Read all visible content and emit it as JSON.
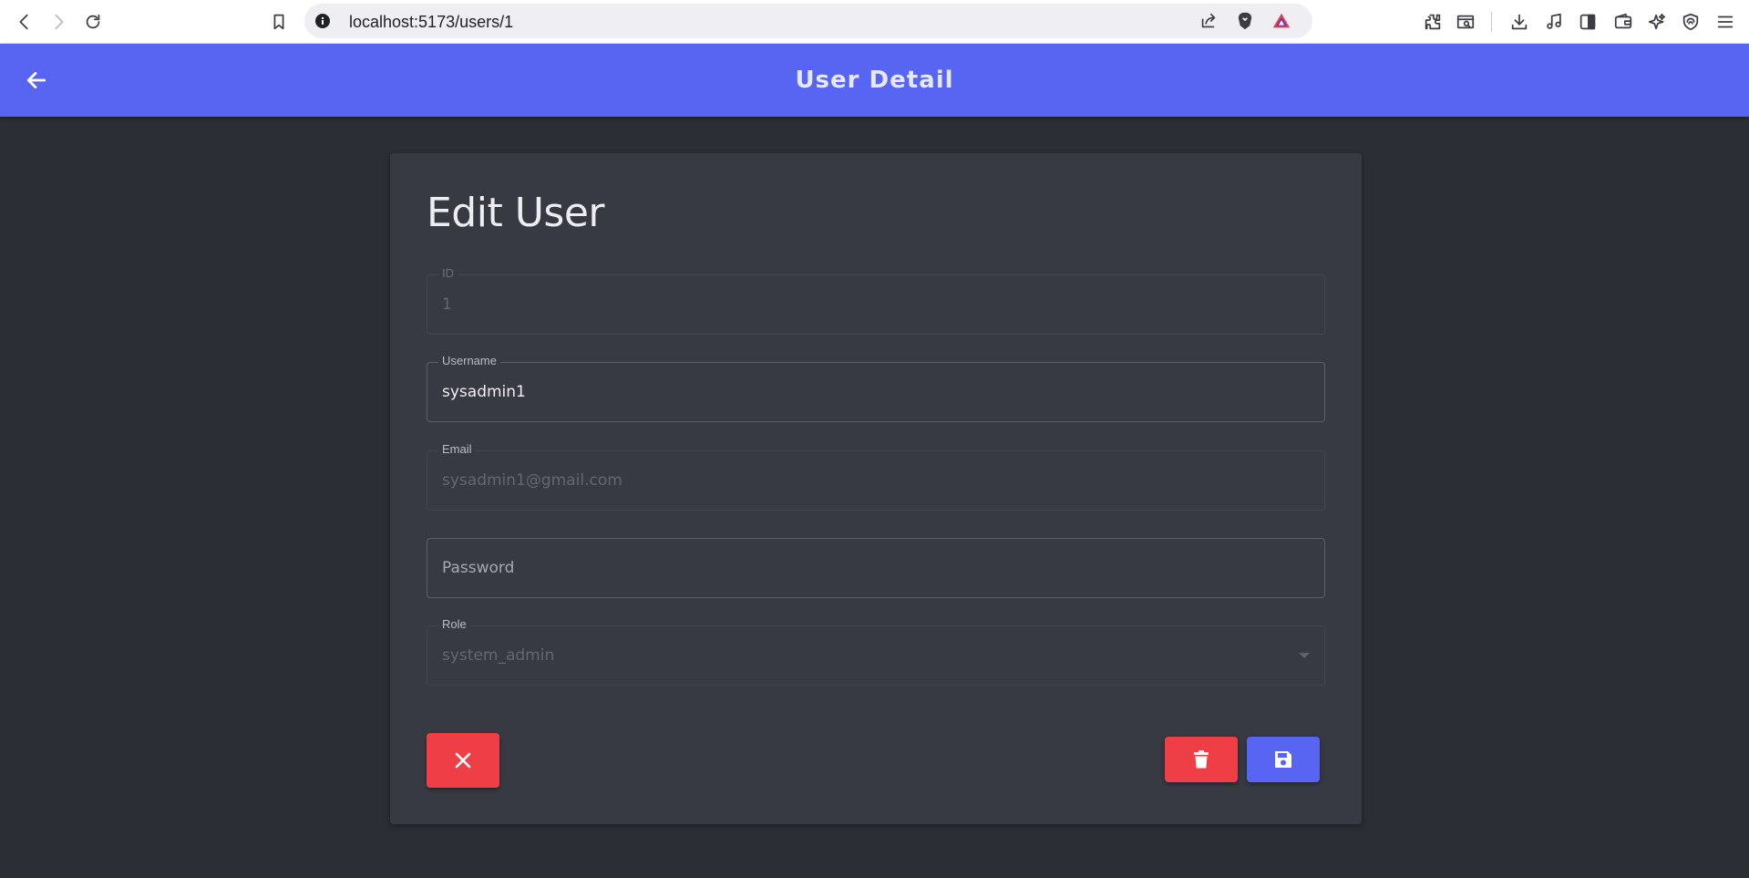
{
  "browser": {
    "url": "localhost:5173/users/1",
    "nav_icons": [
      "back-icon",
      "forward-icon",
      "reload-icon",
      "bookmark-icon"
    ],
    "toolbar_icons": [
      "share-icon",
      "brave-shield-icon",
      "brave-rewards-icon",
      "extensions-icon",
      "reader-mode-icon",
      "downloads-icon",
      "media-icon",
      "sidebar-icon",
      "wallet-icon",
      "leo-ai-icon",
      "vpn-icon",
      "menu-icon"
    ]
  },
  "app_bar": {
    "title": "User Detail",
    "back_icon": "arrow-left-icon"
  },
  "form": {
    "title": "Edit User",
    "fields": {
      "id": {
        "label": "ID",
        "value": "1",
        "disabled": true
      },
      "username": {
        "label": "Username",
        "value": "sysadmin1"
      },
      "email": {
        "label": "Email",
        "value": "sysadmin1@gmail.com",
        "disabled": true
      },
      "password": {
        "placeholder": "Password",
        "value": ""
      },
      "role": {
        "label": "Role",
        "value": "system_admin",
        "disabled": true
      }
    },
    "buttons": {
      "cancel_icon": "close-icon",
      "delete_icon": "trash-icon",
      "save_icon": "floppy-disk-icon"
    }
  },
  "colors": {
    "primary": "#5865f2",
    "danger": "#ef3e45",
    "background": "#2b2e34",
    "card": "#373a42"
  }
}
